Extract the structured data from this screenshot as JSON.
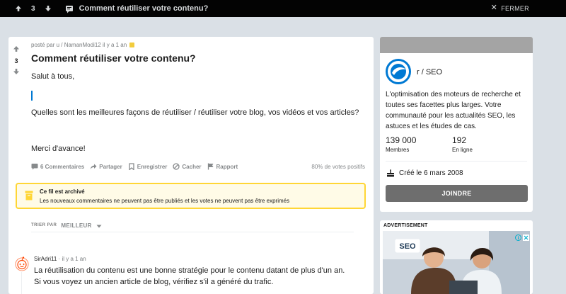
{
  "topbar": {
    "vote_count": "3",
    "post_title": "Comment réutiliser votre contenu?",
    "close_label": "FERMER"
  },
  "post": {
    "vote_count": "3",
    "meta_prefix": "posté par u / NamanModi12 il y a 1 an",
    "title": "Comment réutiliser votre contenu?",
    "body": {
      "greeting": "Salut à tous,",
      "question": "Quelles sont les meilleures façons de réutiliser / réutiliser votre blog, vos vidéos et vos articles?",
      "thanks": "Merci d'avance!"
    },
    "actions": {
      "comments": "6 Commentaires",
      "share": "Partager",
      "save": "Enregistrer",
      "hide": "Cacher",
      "report": "Rapport"
    },
    "upvote_ratio": "80% de votes positifs",
    "archived": {
      "title": "Ce fil est archivé",
      "text": "Les nouveaux commentaires ne peuvent pas être publiés et les votes ne peuvent pas être exprimés"
    },
    "sort": {
      "label": "TRIER PAR",
      "value": "MEILLEUR"
    }
  },
  "comment": {
    "author": "SirAdri11",
    "time": "il y a 1 an",
    "text": "La réutilisation du contenu est une bonne stratégie pour le contenu datant de plus d'un an. Si vous voyez un ancien article de blog, vérifiez s'il a généré du trafic."
  },
  "sidebar": {
    "community_name": "r / SEO",
    "description": "L'optimisation des moteurs de recherche et toutes ses facettes plus larges. Votre communauté pour les actualités SEO, les astuces et les études de cas.",
    "members_count": "139 000",
    "members_label": "Membres",
    "online_count": "192",
    "online_label": "En ligne",
    "created": "Créé le 6 mars 2008",
    "join_label": "JOINDRE",
    "colors": {
      "banner": "#a4a4a4",
      "join": "#6e6e6e",
      "logo": "#0079d3"
    }
  },
  "ad": {
    "label": "ADVERTISEMENT",
    "image_text": "SEO"
  }
}
